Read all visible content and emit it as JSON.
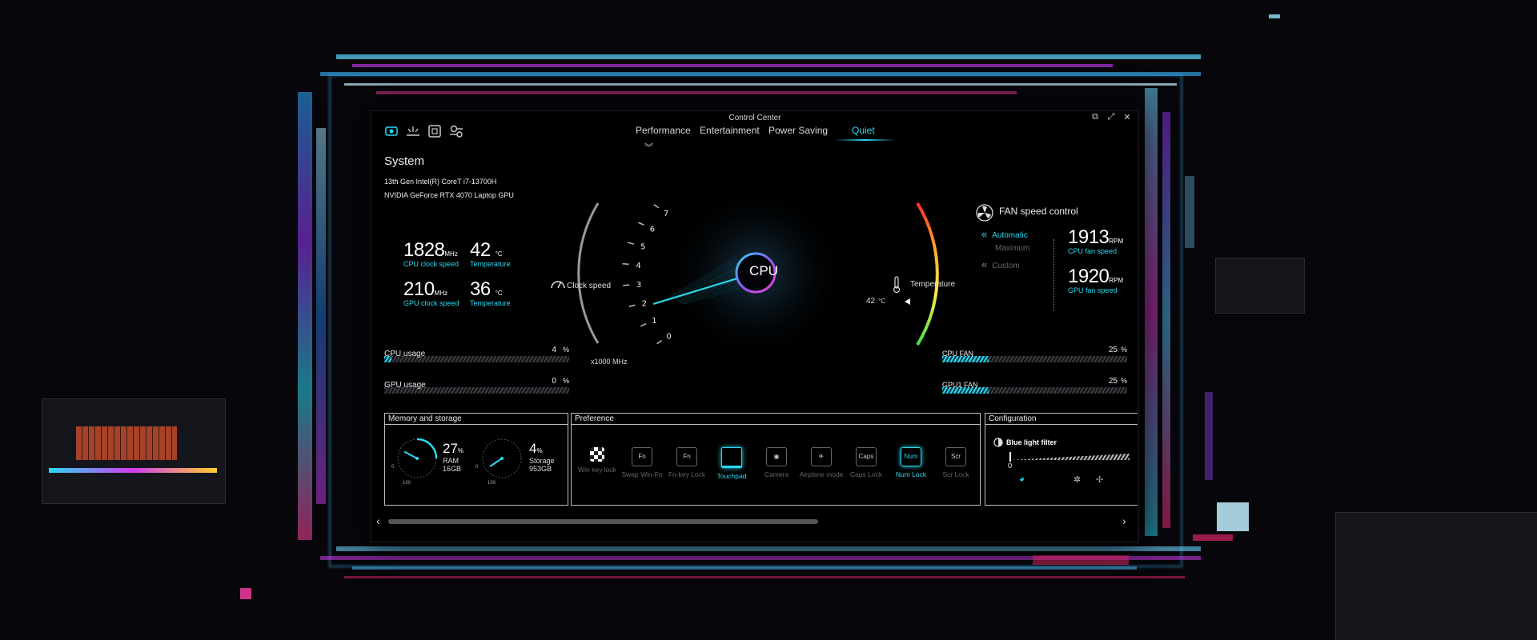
{
  "window": {
    "title": "Control Center"
  },
  "system": {
    "title": "System",
    "cpu_model": "13th Gen Intel(R) CoreT i7-13700H",
    "gpu_model": "NVIDIA GeForce RTX 4070 Laptop GPU"
  },
  "stats": {
    "cpu_clock": "1828",
    "cpu_clock_unit": "MHz",
    "cpu_clock_label": "CPU clock speed",
    "cpu_temp": "42",
    "cpu_temp_unit": "°C",
    "cpu_temp_label": "Temperature",
    "gpu_clock": "210",
    "gpu_clock_unit": "MHz",
    "gpu_clock_label": "GPU clock speed",
    "gpu_temp": "36",
    "gpu_temp_unit": "°C",
    "gpu_temp_label": "Temperature"
  },
  "usage": {
    "cpu_label": "CPU usage",
    "cpu_value": "4",
    "cpu_unit": "%",
    "cpu_fraction": 0.04,
    "gpu_label": "GPU usage",
    "gpu_value": "0",
    "gpu_unit": "%",
    "gpu_fraction": 0.0
  },
  "modes": {
    "items": [
      "Performance",
      "Entertainment",
      "Power Saving",
      "Quiet"
    ],
    "selected": "Quiet"
  },
  "gauge": {
    "center_label": "CPU",
    "clock_label": "Clock speed",
    "temp_label": "Temperature",
    "ticks": [
      "0",
      "1",
      "2",
      "3",
      "4",
      "5",
      "6",
      "7"
    ],
    "unit_label": "x1000 MHz",
    "temp_value": "42",
    "temp_unit": "°C",
    "needle_value": 1.8
  },
  "fan": {
    "title": "FAN speed control",
    "options": [
      "Automatic",
      "Maximum",
      "Custom"
    ],
    "selected": "Automatic",
    "cpu_rpm": "1913",
    "cpu_rpm_unit": "RPM",
    "cpu_rpm_label": "CPU fan speed",
    "gpu_rpm": "1920",
    "gpu_rpm_unit": "RPM",
    "gpu_rpm_label": "GPU fan speed",
    "cpu_fan_label": "CPU FAN",
    "cpu_fan_value": "25",
    "cpu_fan_unit": "%",
    "cpu_fan_fraction": 0.25,
    "gpu_fan_label": "GPU1 FAN",
    "gpu_fan_value": "25",
    "gpu_fan_unit": "%",
    "gpu_fan_fraction": 0.25
  },
  "memory": {
    "title": "Memory and storage",
    "ram_percent": "27",
    "ram_unit": "%",
    "ram_label": "RAM",
    "ram_size": "16GB",
    "storage_percent": "4",
    "storage_unit": "%",
    "storage_label": "Storage",
    "storage_size": "953GB",
    "dial_min": "0",
    "dial_max": "100"
  },
  "preference": {
    "title": "Preference",
    "items": [
      {
        "label": "Win key lock",
        "icon": "grid-icon",
        "glyph": "",
        "active": false
      },
      {
        "label": "Swap Win-Fn",
        "icon": "swap-icon",
        "glyph": "Fn",
        "active": false
      },
      {
        "label": "Fn-key Lock",
        "icon": "fn-key-icon",
        "glyph": "Fn",
        "active": false
      },
      {
        "label": "Touchpad",
        "icon": "touchpad-icon",
        "glyph": "",
        "active": true
      },
      {
        "label": "Camera",
        "icon": "camera-icon",
        "glyph": "◉",
        "active": false
      },
      {
        "label": "Airplane mode",
        "icon": "airplane-icon",
        "glyph": "✈",
        "active": false
      },
      {
        "label": "Caps Lock",
        "icon": "caps-icon",
        "glyph": "Caps",
        "active": false
      },
      {
        "label": "Num Lock",
        "icon": "num-icon",
        "glyph": "Num",
        "active": true
      },
      {
        "label": "Scr Lock",
        "icon": "scr-icon",
        "glyph": "Scr",
        "active": false
      }
    ]
  },
  "configuration": {
    "title": "Configuration",
    "blue_light_label": "Blue light filter",
    "blue_light_value": "0"
  },
  "colors": {
    "accent": "#2ad8f0",
    "bg": "#000000"
  }
}
